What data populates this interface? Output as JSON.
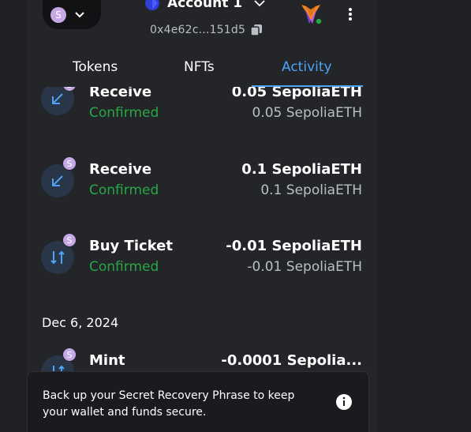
{
  "header": {
    "network_avatar_letter": "S",
    "account_name": "Account 1",
    "address": "0x4e62c...151d5"
  },
  "tabs": [
    {
      "label": "Tokens",
      "active": false
    },
    {
      "label": "NFTs",
      "active": false
    },
    {
      "label": "Activity",
      "active": true
    }
  ],
  "activity": {
    "transactions": [
      {
        "type": "Receive",
        "status": "Confirmed",
        "amount": "0.05 SepoliaETH",
        "fiat": "0.05 SepoliaETH",
        "badge": "S",
        "icon": "receive-arrow-icon"
      },
      {
        "type": "Receive",
        "status": "Confirmed",
        "amount": "0.1 SepoliaETH",
        "fiat": "0.1 SepoliaETH",
        "badge": "S",
        "icon": "receive-arrow-icon"
      },
      {
        "type": "Buy Ticket",
        "status": "Confirmed",
        "amount": "-0.01 SepoliaETH",
        "fiat": "-0.01 SepoliaETH",
        "badge": "S",
        "icon": "contract-interaction-icon"
      }
    ],
    "date_group": "Dec 6, 2024",
    "transactions_2": [
      {
        "type": "Mint",
        "amount": "-0.0001 Sepolia...",
        "badge": "S",
        "icon": "contract-interaction-icon"
      }
    ]
  },
  "banner": {
    "text": "Back up your Secret Recovery Phrase to keep your wallet and funds secure."
  },
  "colors": {
    "accent": "#4fa3f7",
    "confirmed": "#28a745",
    "badge": "#c5a8e6"
  }
}
